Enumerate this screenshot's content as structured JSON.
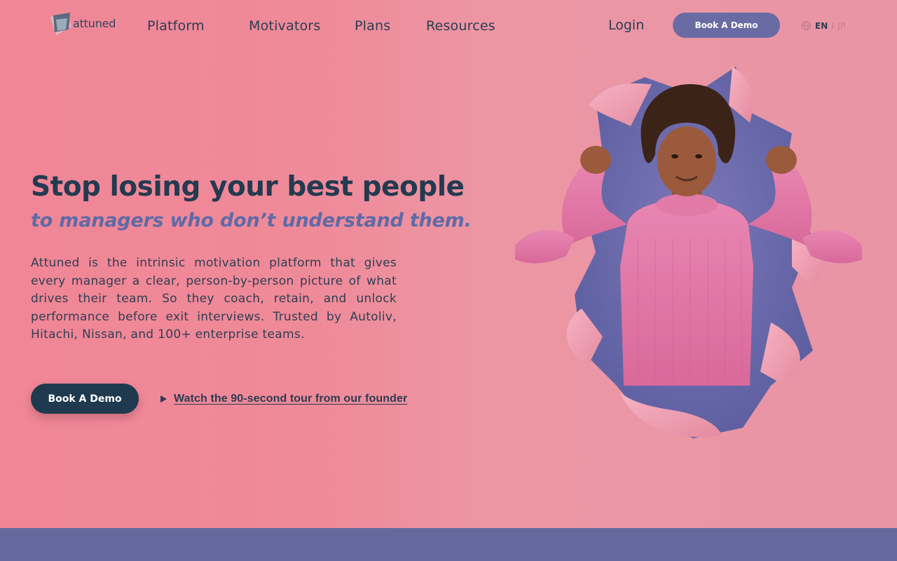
{
  "header": {
    "logo_text": "attuned",
    "nav": [
      "Platform",
      "Motivators",
      "Plans",
      "Resources"
    ],
    "login_label": "Login",
    "demo_label": "Book A Demo",
    "lang_active": "EN",
    "lang_sep": "/",
    "lang_other": "JP"
  },
  "hero": {
    "title": "Stop losing your best people",
    "subtitle": "to managers who don’t understand them.",
    "description": "Attuned is the intrinsic motivation platform that gives every manager a clear, person-by-person picture of what drives their team. So they coach, retain, and unlock performance before exit interviews. Trusted by Autoliv, Hitachi, Nissan, and 100+ enterprise teams.",
    "cta_label": "Book A Demo",
    "watch_label": "Watch the 90-second tour from our founder"
  },
  "colors": {
    "accent": "#6a6ba3",
    "dark": "#1f3a4f",
    "band": "#646a9e",
    "sweater": "#e0739f"
  }
}
